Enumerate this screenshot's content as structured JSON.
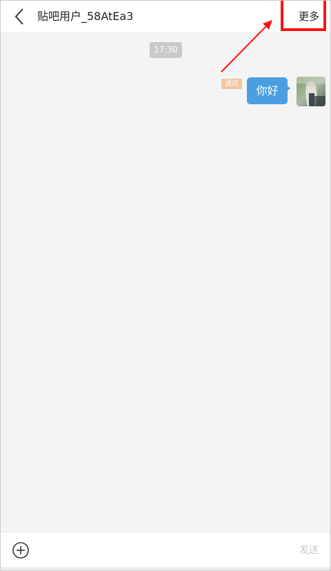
{
  "header": {
    "title": "贴吧用户_58AtEa3",
    "more_label": "更多",
    "back_icon": "chevron-left-icon"
  },
  "chat": {
    "timestamp": "17:30",
    "messages": [
      {
        "text": "你好",
        "status": "送达",
        "bubble_color": "#4a9fe0"
      }
    ]
  },
  "input_bar": {
    "add_icon": "plus-circle-icon",
    "send_label": "发送"
  },
  "annotation": {
    "highlight_color": "#ff1010"
  }
}
